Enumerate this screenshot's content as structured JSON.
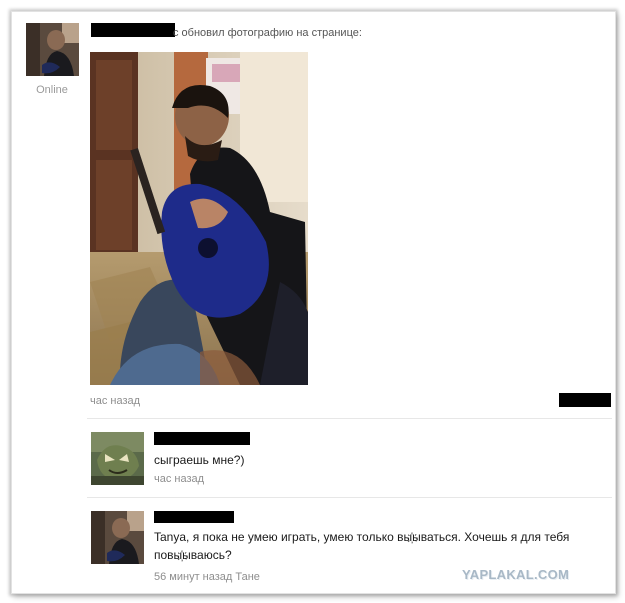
{
  "status": {
    "online": "Online"
  },
  "post": {
    "header_text": "с обновил фотографию на странице:",
    "time": "час назад"
  },
  "comments": [
    {
      "text": "сыграешь мне?)",
      "time": "час назад"
    },
    {
      "text_line1": "Tanya, я пока не умею играть, умею только вы҉ываться. Хочешь я для тебя",
      "text_line2": "повы҉ываюсь?",
      "time": "56 минут назад Тане"
    }
  ],
  "watermark": {
    "text": "YAPLAKAL.COM"
  },
  "colors": {
    "redaction": "#000000",
    "meta_text": "#8e8e8e",
    "watermark": "#a8b8c6"
  }
}
